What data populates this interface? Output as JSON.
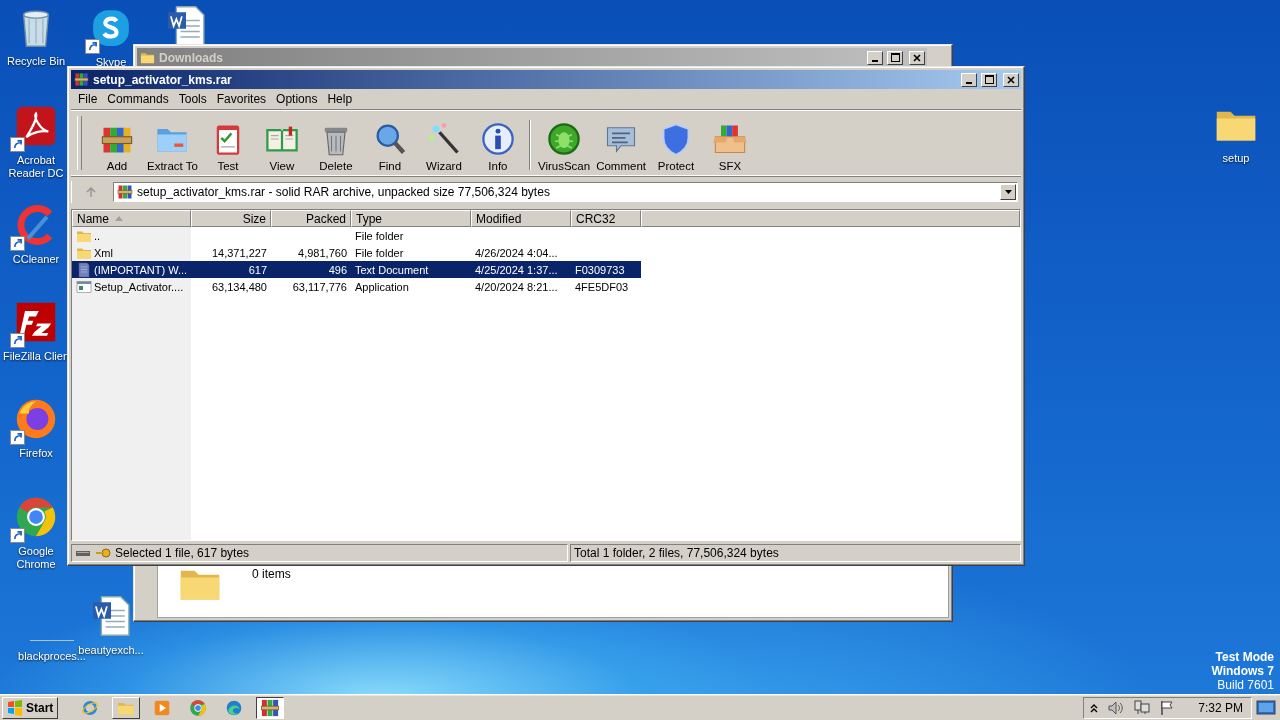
{
  "desktop_icons": [
    {
      "kind": "recycle-bin",
      "label": "Recycle Bin",
      "shortcut": false
    },
    {
      "kind": "skype",
      "label": "Skype",
      "shortcut": true
    },
    {
      "kind": "word",
      "shortcut": false
    },
    {
      "kind": "acrobat",
      "label": "Acrobat\nReader DC",
      "shortcut": true
    },
    {
      "kind": "ccleaner",
      "label": "CCleaner",
      "shortcut": true
    },
    {
      "kind": "filezilla",
      "label": "FileZilla Clien",
      "shortcut": true
    },
    {
      "kind": "firefox",
      "label": "Firefox",
      "shortcut": true
    },
    {
      "kind": "chrome",
      "label": "Google\nChrome",
      "shortcut": true
    },
    {
      "kind": "blank",
      "label": "blackproces...",
      "shortcut": false
    },
    {
      "kind": "word",
      "label": "beautyexch...",
      "shortcut": false
    },
    {
      "kind": "folder",
      "label": "setup",
      "shortcut": false
    }
  ],
  "explorer_window": {
    "title": "Downloads",
    "active": false,
    "details": "0 items"
  },
  "archive_window": {
    "title": "setup_activator_kms.rar",
    "active": true,
    "menu": [
      "File",
      "Commands",
      "Tools",
      "Favorites",
      "Options",
      "Help"
    ],
    "toolbar": [
      {
        "kind": "add",
        "label": "Add"
      },
      {
        "kind": "extract",
        "label": "Extract To"
      },
      {
        "kind": "test",
        "label": "Test"
      },
      {
        "kind": "view",
        "label": "View"
      },
      {
        "kind": "delete",
        "label": "Delete"
      },
      {
        "kind": "find",
        "label": "Find"
      },
      {
        "kind": "wizard",
        "label": "Wizard"
      },
      {
        "kind": "info",
        "label": "Info"
      }
    ],
    "extra_tools": [
      {
        "kind": "virusscan",
        "label": "VirusScan"
      },
      {
        "kind": "comment",
        "label": "Comment"
      },
      {
        "kind": "protect",
        "label": "Protect"
      },
      {
        "kind": "sfx",
        "label": "SFX"
      }
    ],
    "address": "setup_activator_kms.rar - solid RAR archive, unpacked size 77,506,324 bytes",
    "columns": [
      {
        "label": "Name",
        "sorted": true
      },
      {
        "label": "Size",
        "sorted": false
      },
      {
        "label": "Packed",
        "sorted": false
      },
      {
        "label": "Type",
        "sorted": false
      },
      {
        "label": "Modified",
        "sorted": false
      },
      {
        "label": "CRC32",
        "sorted": false
      }
    ],
    "rows": [
      {
        "kind": "folder",
        "name": "..",
        "type": "File folder",
        "selected": false
      },
      {
        "kind": "folder",
        "name": "Xml",
        "size": "14,371,227",
        "packed": "4,981,760",
        "type": "File folder",
        "modified": "4/26/2024 4:04...",
        "selected": false
      },
      {
        "kind": "text",
        "name": "(IMPORTANT) W...",
        "size": "617",
        "packed": "496",
        "type": "Text Document",
        "modified": "4/25/2024 1:37...",
        "crc32": "F0309733",
        "selected": true
      },
      {
        "kind": "app",
        "name": "Setup_Activator....",
        "size": "63,134,480",
        "packed": "63,117,776",
        "type": "Application",
        "modified": "4/20/2024 8:21...",
        "crc32": "4FE5DF03",
        "selected": false
      }
    ],
    "status_left": "Selected 1 file, 617 bytes",
    "status_right": "Total 1 folder, 2 files, 77,506,324 bytes"
  },
  "desktop_notice": [
    "Test Mode",
    "Windows 7",
    "Build 7601"
  ],
  "taskbar": {
    "start": "Start",
    "apps": [
      {
        "kind": "ie",
        "open": false,
        "selected": false
      },
      {
        "kind": "explorer",
        "open": true,
        "selected": false
      },
      {
        "kind": "media",
        "open": false,
        "selected": false
      },
      {
        "kind": "chrome",
        "open": false,
        "selected": false
      },
      {
        "kind": "edge",
        "open": false,
        "selected": false
      },
      {
        "kind": "winrar",
        "open": true,
        "selected": true
      }
    ],
    "clock": "7:32 PM"
  }
}
